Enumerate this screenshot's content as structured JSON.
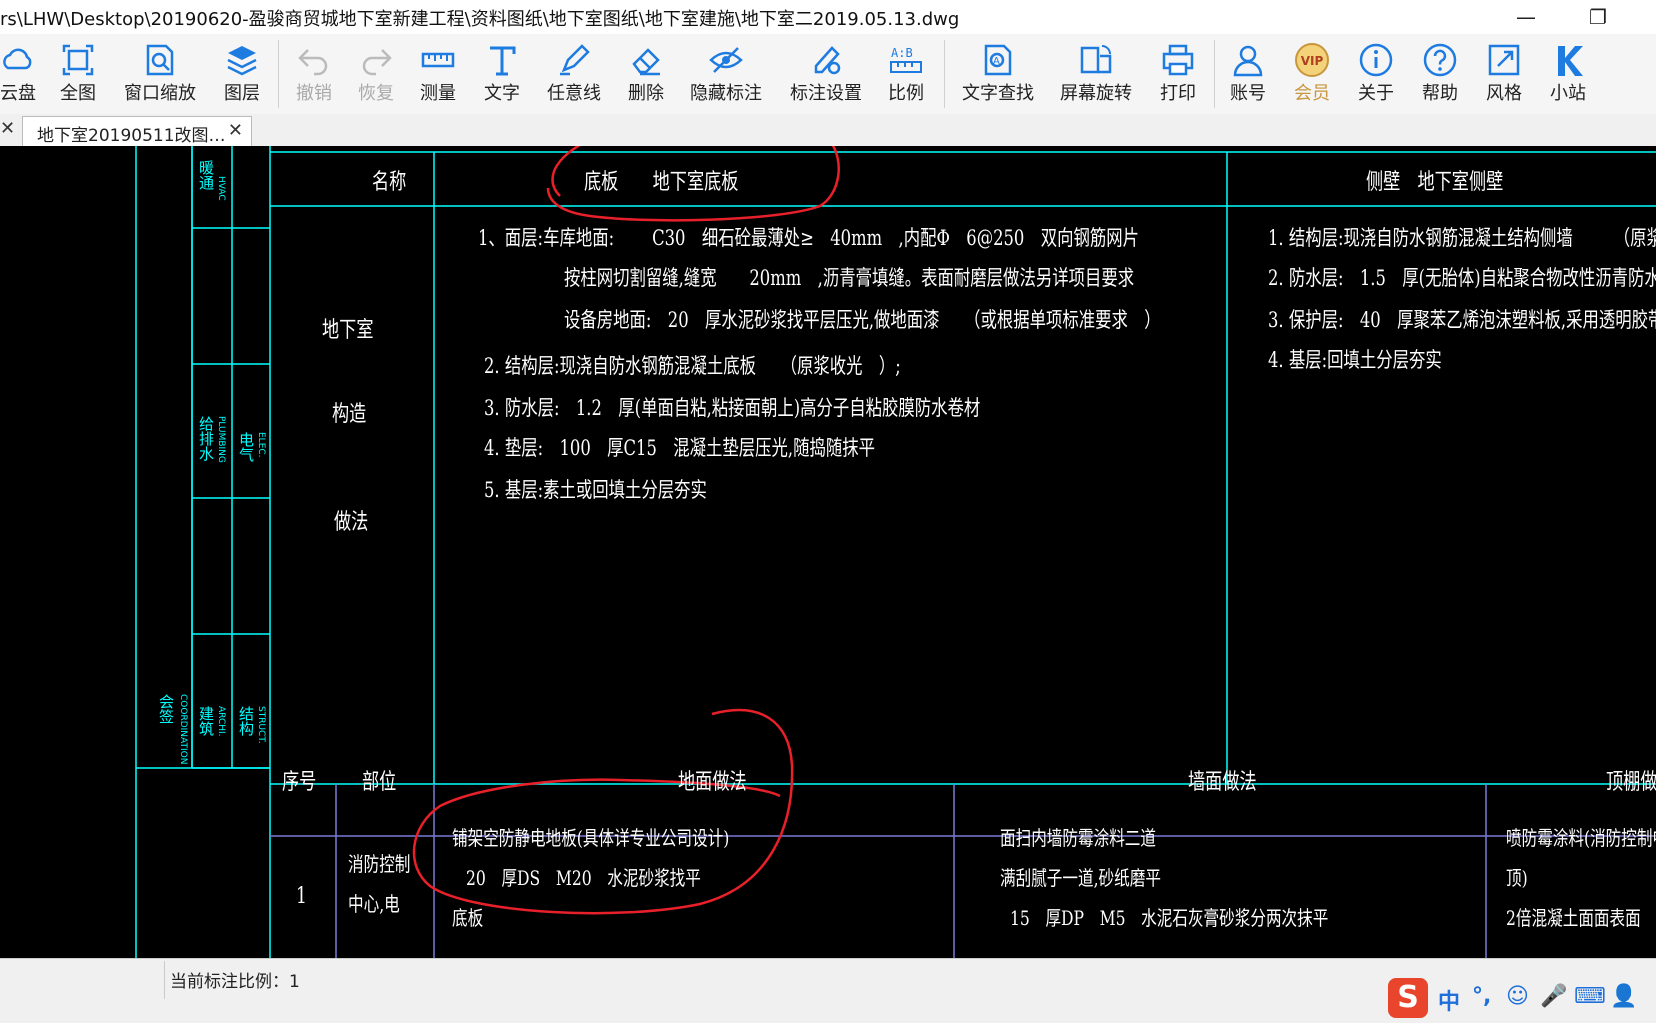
{
  "window": {
    "title": "rs\\LHW\\Desktop\\20190620-盈骏商贸城地下室新建工程\\资料图纸\\地下室图纸\\地下室建施\\地下室二2019.05.13.dwg",
    "minimize": "—",
    "restore": "❐"
  },
  "toolbar": {
    "items": [
      {
        "label": "云盘",
        "icon": "cloud-icon"
      },
      {
        "label": "全图",
        "icon": "fit-all-icon"
      },
      {
        "label": "窗口缩放",
        "icon": "window-zoom-icon"
      },
      {
        "label": "图层",
        "icon": "layers-icon"
      },
      {
        "label": "撤销",
        "icon": "undo-icon",
        "disabled": true
      },
      {
        "label": "恢复",
        "icon": "redo-icon",
        "disabled": true
      },
      {
        "label": "测量",
        "icon": "ruler-icon"
      },
      {
        "label": "文字",
        "icon": "text-icon"
      },
      {
        "label": "任意线",
        "icon": "pen-icon"
      },
      {
        "label": "删除",
        "icon": "eraser-icon"
      },
      {
        "label": "隐藏标注",
        "icon": "hide-icon"
      },
      {
        "label": "标注设置",
        "icon": "annotation-settings-icon"
      },
      {
        "label": "比例",
        "icon": "scale-icon"
      },
      {
        "label": "文字查找",
        "icon": "text-search-icon"
      },
      {
        "label": "屏幕旋转",
        "icon": "rotate-icon"
      },
      {
        "label": "打印",
        "icon": "printer-icon"
      },
      {
        "label": "账号",
        "icon": "user-icon"
      },
      {
        "label": "会员",
        "icon": "vip-icon"
      },
      {
        "label": "关于",
        "icon": "info-icon"
      },
      {
        "label": "帮助",
        "icon": "help-icon"
      },
      {
        "label": "风格",
        "icon": "style-icon"
      },
      {
        "label": "小站",
        "icon": "k-station-icon"
      }
    ],
    "vip_badge": "VIP"
  },
  "tabs": {
    "left_close": "✕",
    "active_label": "地下室20190511改图…",
    "close": "✕"
  },
  "drawing": {
    "top_table": {
      "col_name": "名称",
      "col_floor": "底板　　地下室底板",
      "col_wall": "侧壁　地下室侧壁",
      "row_label_1": "地下室",
      "row_label_2": "构造",
      "row_label_3": "做法",
      "floor_lines": [
        "1、面层:车库地面:　　 C30　细石砼最薄处≥　40mm　,内配Φ　6@250　双向钢筋网片",
        "按柱网切割留缝,缝宽　　20mm　,沥青膏填缝。表面耐磨层做法另详项目要求",
        "设备房地面:　20　厚水泥砂浆找平层压光,做地面漆　　（或根据单项标准要求　）",
        "2. 结构层:现浇自防水钢筋混凝土底板　　（原浆收光　）;",
        "3. 防水层:　1.2　厚(单面自粘,粘接面朝上)高分子自粘胶膜防水卷材",
        "4. 垫层:　100　厚C15　混凝土垫层压光,随捣随抹平",
        "5. 基层:素土或回填土分层夯实"
      ],
      "wall_lines": [
        "1. 结构层:现浇自防水钢筋混凝土结构侧墙　　　（原浆",
        "2. 防水层:　1.5　厚(无胎体)自粘聚合物改性沥青防水卷材",
        "3. 保护层:　40　厚聚苯乙烯泡沫塑料板,采用透明胶带粘",
        "4. 基层:回填土分层夯实"
      ]
    },
    "bottom_table": {
      "col_no": "序号",
      "col_part": "部位",
      "col_ground": "地面做法",
      "col_wall": "墙面做法",
      "col_ceiling": "顶棚做",
      "row_no": "1",
      "row_part_1": "消防控制",
      "row_part_2": "中心,电",
      "ground_1": "铺架空防静电地板(具体详专业公司设计)",
      "ground_2": "20　厚DS　M20　水泥砂浆找平",
      "ground_3": "底板",
      "wall_1": "面扫内墙防霉涂料二道",
      "wall_2": "满刮腻子一道,砂纸磨平",
      "wall_3": "15　厚DP　M5　水泥石灰膏砂浆分两次抹平",
      "ceil_1": "喷防霉涂料(消防控制中",
      "ceil_2": "顶)",
      "ceil_3": "2倍混凝土面面表面"
    },
    "sign_block": {
      "hvac": "暖通",
      "hvac_en": "HVAC",
      "plumbing": "给排水",
      "plumbing_en": "PLUMBING",
      "elec": "电气",
      "elec_en": "ELEC.",
      "coord": "会签",
      "coord_en": "COORDINATION",
      "arch": "建筑",
      "arch_en": "ARCHI.",
      "struct": "结构",
      "struct_en": "STRUCT."
    }
  },
  "status": {
    "scale_label": "当前标注比例：1"
  },
  "ime": {
    "logo": "S",
    "lang": "中",
    "punct": "°,",
    "emoji": "☺",
    "mic": "🎤",
    "keyboard": "⌨",
    "user": "👤"
  },
  "colors": {
    "cad_background": "#000000",
    "cad_lines": "#00ffff",
    "table_lines": "#7b7bd8",
    "annotation_red": "#e8202a"
  }
}
